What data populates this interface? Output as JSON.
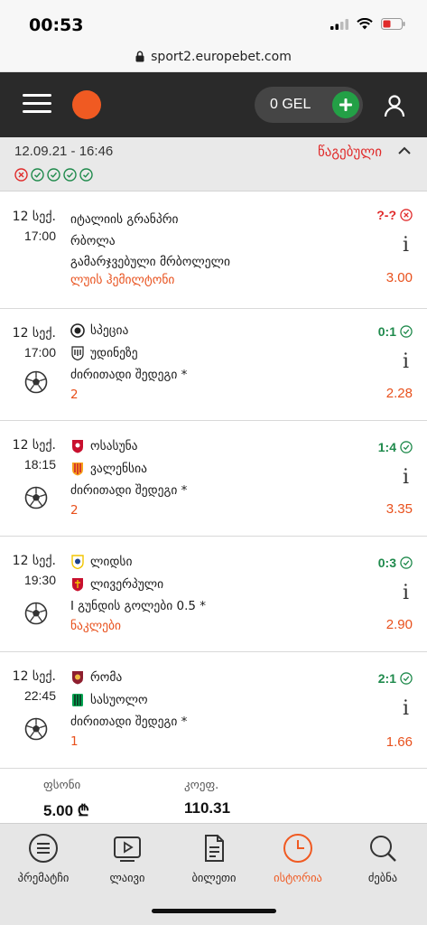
{
  "status_bar": {
    "time": "00:53"
  },
  "browser": {
    "url": "sport2.europebet.com"
  },
  "header": {
    "balance": "0 GEL"
  },
  "bet": {
    "datetime": "12.09.21 - 16:46",
    "status": "წაგებული",
    "outcomes": [
      "lost",
      "won",
      "won",
      "won",
      "won"
    ]
  },
  "events": [
    {
      "date": "12 სექ.",
      "time": "17:00",
      "sport_icon": "",
      "line1": "იტალიის გრანპრი",
      "line2": "რბოლა",
      "market": "გამარჯვებული მრბოლელი",
      "selection": "ლუის ჰემილტონი",
      "score": "?-?",
      "result": "lost",
      "odds": "3.00"
    },
    {
      "date": "12 სექ.",
      "time": "17:00",
      "sport_icon": "soccer-ball-icon",
      "team1": "სპეცია",
      "team2": "უდინეზე",
      "market": "ძირითადი შედეგი *",
      "selection": "2",
      "score": "0:1",
      "result": "won",
      "odds": "2.28"
    },
    {
      "date": "12 სექ.",
      "time": "18:15",
      "sport_icon": "soccer-ball-icon",
      "team1": "ოსასუნა",
      "team2": "ვალენსია",
      "market": "ძირითადი შედეგი *",
      "selection": "2",
      "score": "1:4",
      "result": "won",
      "odds": "3.35"
    },
    {
      "date": "12 სექ.",
      "time": "19:30",
      "sport_icon": "soccer-ball-icon",
      "team1": "ლიდსი",
      "team2": "ლივერპული",
      "market": "I გუნდის გოლები 0.5 *",
      "selection": "ნაკლები",
      "score": "0:3",
      "result": "won",
      "odds": "2.90"
    },
    {
      "date": "12 სექ.",
      "time": "22:45",
      "sport_icon": "soccer-ball-icon",
      "team1": "რომა",
      "team2": "სასუოლო",
      "market": "ძირითადი შედეგი *",
      "selection": "1",
      "score": "2:1",
      "result": "won",
      "odds": "1.66"
    }
  ],
  "totals": {
    "stake_label": "ფსონი",
    "stake_value": "5.00 ₾",
    "odds_label": "კოეფ.",
    "odds_value": "110.31"
  },
  "tabs": [
    {
      "label": "პრემატჩი",
      "icon": "list-circle-icon",
      "active": false
    },
    {
      "label": "ლაივი",
      "icon": "play-icon",
      "active": false
    },
    {
      "label": "ბილეთი",
      "icon": "ticket-icon",
      "active": false
    },
    {
      "label": "ისტორია",
      "icon": "clock-icon",
      "active": true
    },
    {
      "label": "ძებნა",
      "icon": "search-icon",
      "active": false
    }
  ],
  "colors": {
    "accent": "#f05a22",
    "win": "#1f8a4c",
    "lose": "#e02a2a",
    "header_bg": "#2a2a2a",
    "add_button": "#23a046"
  }
}
